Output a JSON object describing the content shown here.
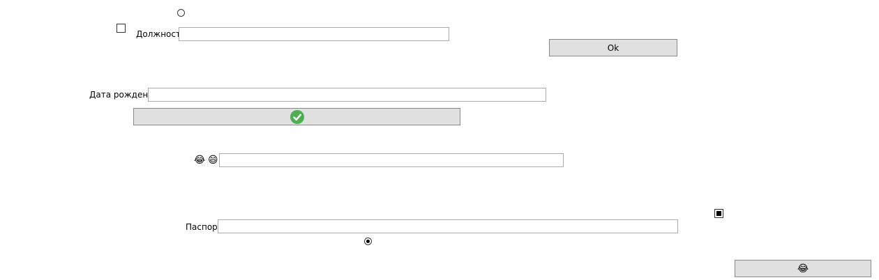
{
  "radio_top": {
    "checked": false
  },
  "checkbox_left": {
    "checked": false
  },
  "position_field": {
    "label": "Должность",
    "value": ""
  },
  "ok_button": {
    "label": "Ok"
  },
  "birthdate_field": {
    "label": "Дата рождения",
    "value": ""
  },
  "confirm_button": {
    "icon": "check-circle-icon",
    "color": "#4caf50"
  },
  "emoji_field": {
    "emoji1": "😂",
    "emoji2": "😄",
    "value": ""
  },
  "checkbox_right": {
    "state": "indeterminate"
  },
  "passport_field": {
    "label": "Паспорт",
    "value": ""
  },
  "radio_bottom": {
    "checked": true
  },
  "emoji_button": {
    "emoji": "😂"
  }
}
